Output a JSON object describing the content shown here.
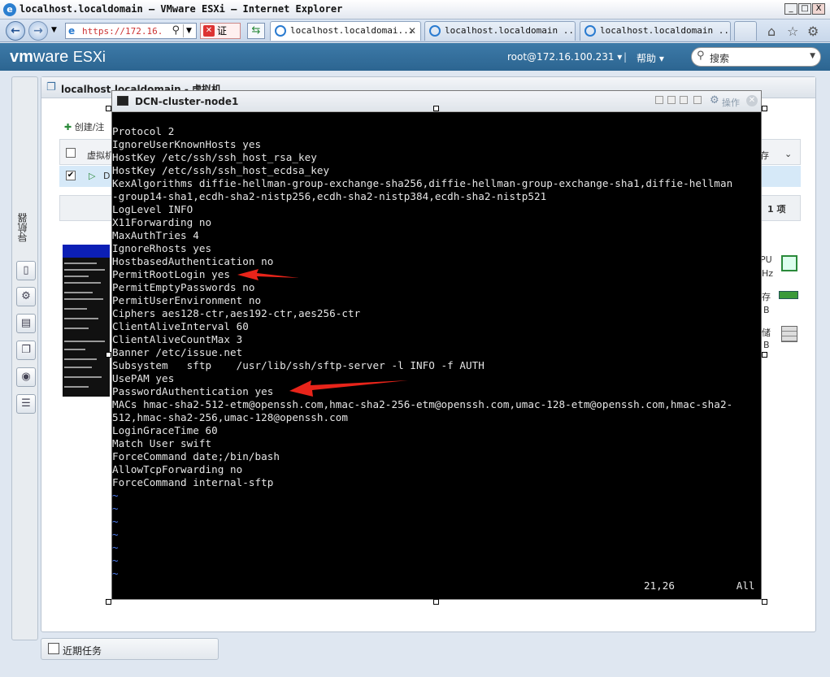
{
  "window": {
    "title": "localhost.localdomain — VMware ESXi — Internet Explorer",
    "min": "_",
    "max": "□",
    "close": "X"
  },
  "browser": {
    "address": "https://172.16.",
    "cert_label": "证",
    "tabs": [
      {
        "label": "localhost.localdomai...",
        "close": "✕"
      },
      {
        "label": "localhost.localdomain ..."
      },
      {
        "label": "localhost.localdomain ..."
      }
    ]
  },
  "esxi": {
    "logo_vm": "vm",
    "logo_ware": "ware",
    "logo_product": "ESXi",
    "user": "root@172.16.100.231 ▾",
    "sep": "|",
    "help": "帮助 ▾",
    "search_placeholder": "搜索"
  },
  "navigator": {
    "label": "导航器"
  },
  "main": {
    "title": "localhost.localdomain - 虚拟机",
    "create_label": "创建/注",
    "col_vm": "虚拟机",
    "col_storage": "存",
    "row_first": "D",
    "count": "1 项",
    "hw_cpu": "PU",
    "hw_cpu_unit": "Hz",
    "hw_mem": "存",
    "hw_mem_unit": "B",
    "hw_disk": "储",
    "hw_disk_unit": "B"
  },
  "recent_tasks": "近期任务",
  "console": {
    "title": "DCN-cluster-node1",
    "actions": "操作",
    "lines": [
      "Protocol 2",
      "IgnoreUserKnownHosts yes",
      "HostKey /etc/ssh/ssh_host_rsa_key",
      "HostKey /etc/ssh/ssh_host_ecdsa_key",
      "KexAlgorithms diffie-hellman-group-exchange-sha256,diffie-hellman-group-exchange-sha1,diffie-hellman",
      "-group14-sha1,ecdh-sha2-nistp256,ecdh-sha2-nistp384,ecdh-sha2-nistp521",
      "LogLevel INFO",
      "X11Forwarding no",
      "MaxAuthTries 4",
      "IgnoreRhosts yes",
      "HostbasedAuthentication no",
      "PermitRootLogin yes",
      "PermitEmptyPasswords no",
      "PermitUserEnvironment no",
      "Ciphers aes128-ctr,aes192-ctr,aes256-ctr",
      "ClientAliveInterval 60",
      "ClientAliveCountMax 3",
      "Banner /etc/issue.net",
      "Subsystem   sftp    /usr/lib/ssh/sftp-server -l INFO -f AUTH",
      "UsePAM yes",
      "PasswordAuthentication yes",
      "MACs hmac-sha2-512-etm@openssh.com,hmac-sha2-256-etm@openssh.com,umac-128-etm@openssh.com,hmac-sha2-",
      "512,hmac-sha2-256,umac-128@openssh.com",
      "LoginGraceTime 60",
      "Match User swift",
      "ForceCommand date;/bin/bash",
      "AllowTcpForwarding no",
      "ForceCommand internal-sftp"
    ],
    "tildes": [
      "~",
      "~",
      "~",
      "~",
      "~",
      "~",
      "~"
    ],
    "status": "21,26          All",
    "arrow_color": "#e8241a"
  }
}
